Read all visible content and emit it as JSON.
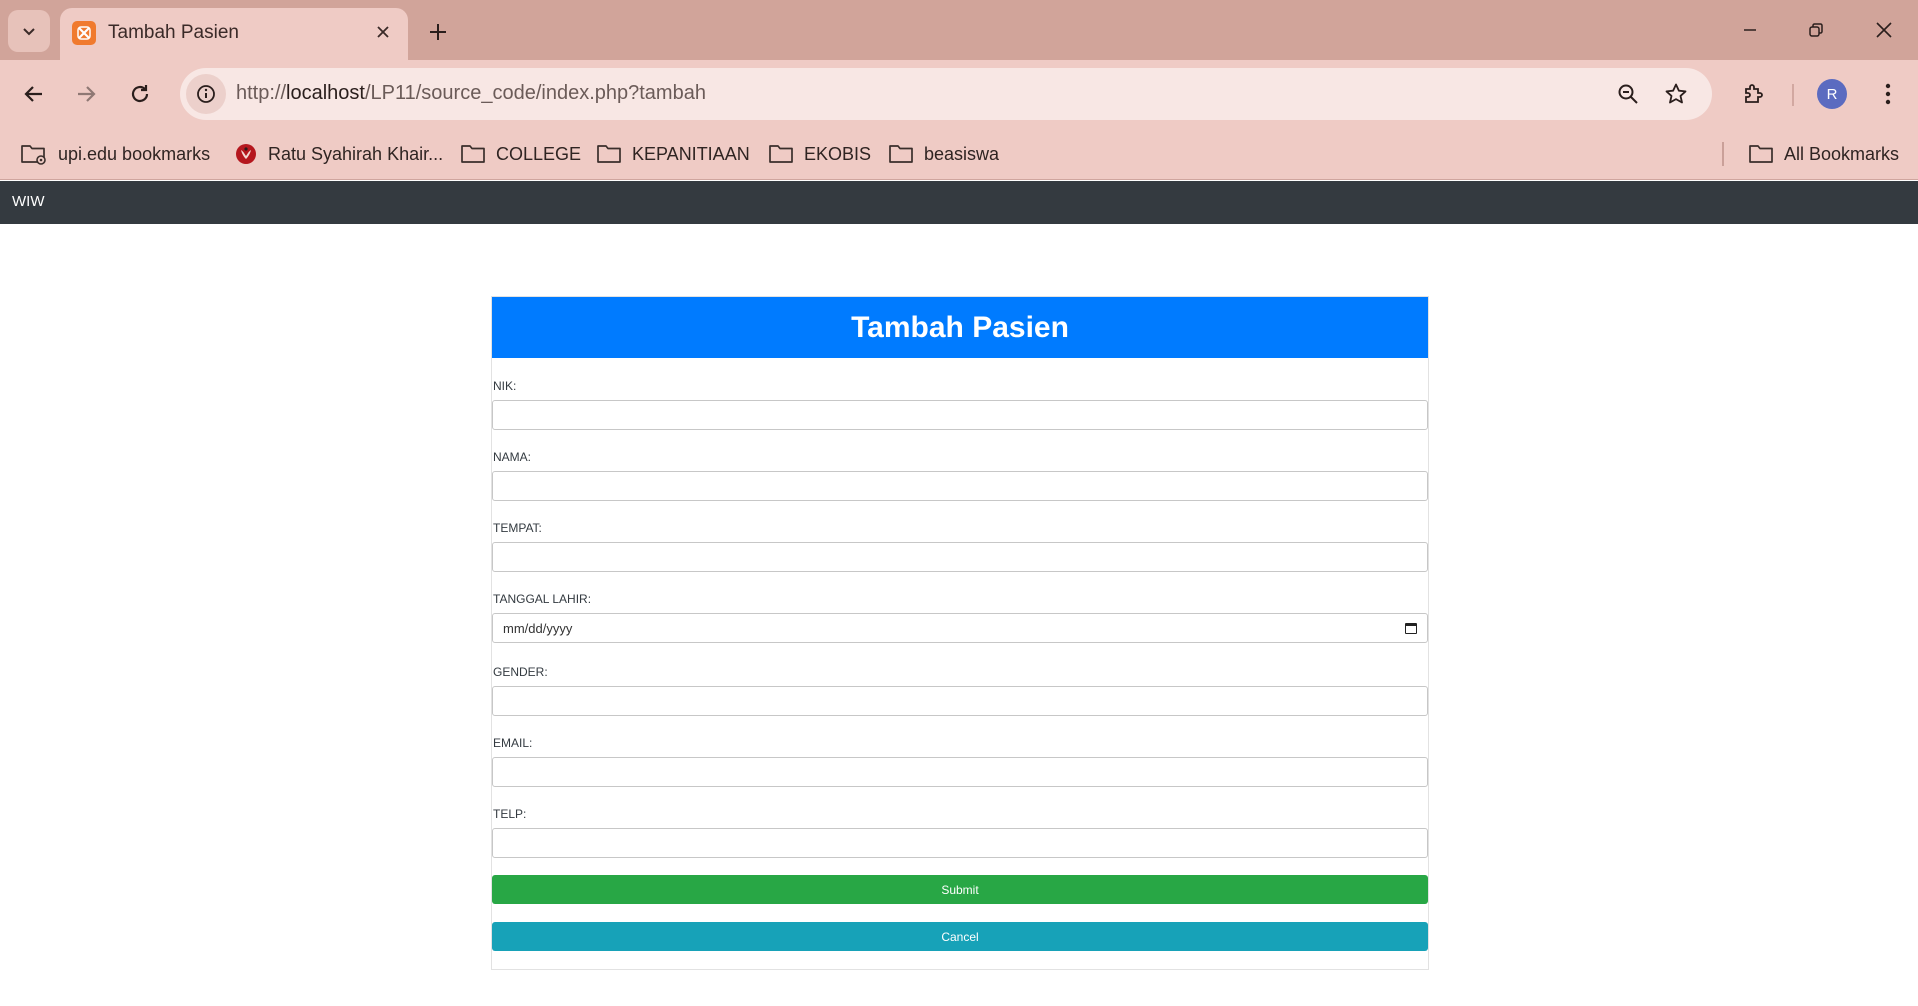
{
  "browser": {
    "tab": {
      "title": "Tambah Pasien"
    },
    "address": {
      "scheme": "http://",
      "host": "localhost",
      "path": "/LP11/source_code/index.php?tambah"
    },
    "profile_initial": "R",
    "bookmarks": [
      {
        "label": "upi.edu bookmarks",
        "icon": "managed-folder-icon"
      },
      {
        "label": "Ratu Syahirah Khair...",
        "icon": "site-favicon-icon"
      },
      {
        "label": "COLLEGE",
        "icon": "folder-icon"
      },
      {
        "label": "KEPANITIAAN",
        "icon": "folder-icon"
      },
      {
        "label": "EKOBIS",
        "icon": "folder-icon"
      },
      {
        "label": "beasiswa",
        "icon": "folder-icon"
      }
    ],
    "all_bookmarks": "All Bookmarks"
  },
  "navbar": {
    "brand": "WIW"
  },
  "form": {
    "title": "Tambah Pasien",
    "fields": [
      {
        "label": "NIK:",
        "value": ""
      },
      {
        "label": "NAMA:",
        "value": ""
      },
      {
        "label": "TEMPAT:",
        "value": ""
      },
      {
        "label": "TANGGAL LAHIR:",
        "placeholder": "mm/dd/yyyy"
      },
      {
        "label": "GENDER:",
        "value": ""
      },
      {
        "label": "EMAIL:",
        "value": ""
      },
      {
        "label": "TELP:",
        "value": ""
      }
    ],
    "submit_label": "Submit",
    "cancel_label": "Cancel"
  },
  "colors": {
    "header": "#007bff",
    "submit": "#28a745",
    "cancel": "#17a2b8",
    "navbar": "#343a40",
    "chrome": "#efcbc5"
  }
}
